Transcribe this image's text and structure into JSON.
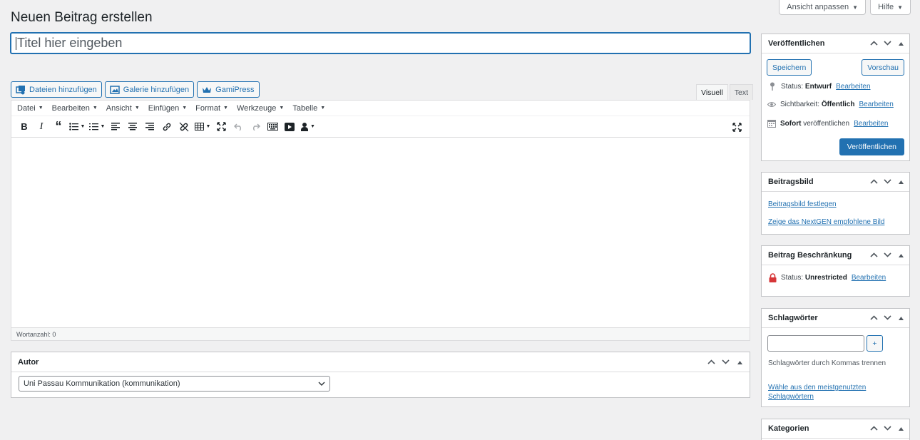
{
  "screen_options": {
    "view_label": "Ansicht anpassen",
    "help_label": "Hilfe"
  },
  "page": {
    "title": "Neuen Beitrag erstellen",
    "title_placeholder": "Titel hier eingeben"
  },
  "media_buttons": {
    "add_files": "Dateien hinzufügen",
    "add_gallery": "Galerie hinzufügen",
    "gamipress": "GamiPress"
  },
  "editor": {
    "tabs": [
      "Visuell",
      "Text"
    ],
    "menus": [
      "Datei",
      "Bearbeiten",
      "Ansicht",
      "Einfügen",
      "Format",
      "Werkzeuge",
      "Tabelle"
    ],
    "word_count": "Wortanzahl: 0"
  },
  "author": {
    "title": "Autor",
    "selected": "Uni Passau Kommunikation (kommunikation)"
  },
  "publish": {
    "title": "Veröffentlichen",
    "save_label": "Speichern",
    "preview_label": "Vorschau",
    "status_label": "Status:",
    "status_value": "Entwurf",
    "visibility_label": "Sichtbarkeit:",
    "visibility_value": "Öffentlich",
    "schedule_value": "Sofort",
    "schedule_label": "veröffentlichen",
    "edit_label": "Bearbeiten",
    "publish_label": "Veröffentlichen",
    "accent": "#2271b1"
  },
  "featured_image": {
    "title": "Beitragsbild",
    "set_link": "Beitragsbild festlegen",
    "nextgen_link": "Zeige das NextGEN empfohlene Bild"
  },
  "restriction": {
    "title": "Beitrag Beschränkung",
    "status_label": "Status:",
    "status_value": "Unrestricted",
    "edit_label": "Bearbeiten",
    "lock_color": "#d63638"
  },
  "tags": {
    "title": "Schlagwörter",
    "add_label": "+",
    "hint": "Schlagwörter durch Kommas trennen",
    "popular_link": "Wähle aus den meistgenutzten Schlagwörtern"
  },
  "categories": {
    "title": "Kategorien"
  }
}
